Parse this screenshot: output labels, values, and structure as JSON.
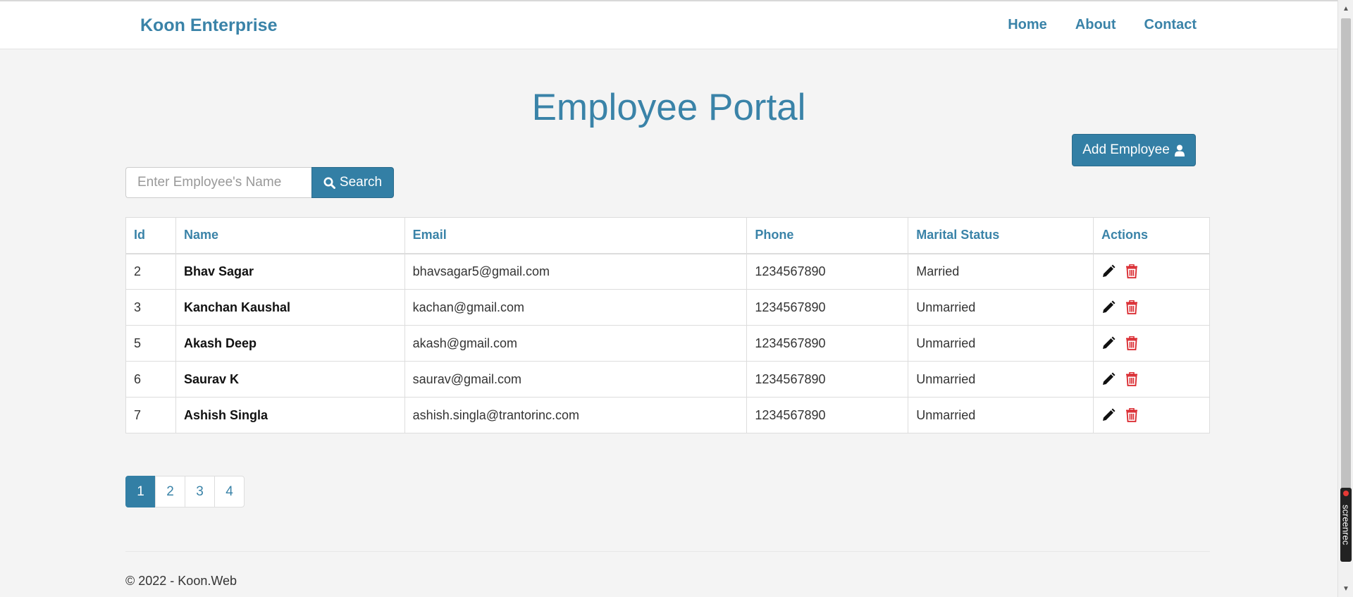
{
  "navbar": {
    "brand": "Koon Enterprise",
    "links": [
      "Home",
      "About",
      "Contact"
    ]
  },
  "main": {
    "title": "Employee Portal",
    "add_button_label": "Add Employee",
    "search": {
      "placeholder": "Enter Employee's Name",
      "value": "",
      "button_label": "Search"
    }
  },
  "table": {
    "columns": [
      "Id",
      "Name",
      "Email",
      "Phone",
      "Marital Status",
      "Actions"
    ],
    "rows": [
      {
        "id": "2",
        "name": "Bhav Sagar",
        "email": "bhavsagar5@gmail.com",
        "phone": "1234567890",
        "status": "Married"
      },
      {
        "id": "3",
        "name": "Kanchan Kaushal",
        "email": "kachan@gmail.com",
        "phone": "1234567890",
        "status": "Unmarried"
      },
      {
        "id": "5",
        "name": "Akash Deep",
        "email": "akash@gmail.com",
        "phone": "1234567890",
        "status": "Unmarried"
      },
      {
        "id": "6",
        "name": "Saurav K",
        "email": "saurav@gmail.com",
        "phone": "1234567890",
        "status": "Unmarried"
      },
      {
        "id": "7",
        "name": "Ashish Singla",
        "email": "ashish.singla@trantorinc.com",
        "phone": "1234567890",
        "status": "Unmarried"
      }
    ]
  },
  "pagination": {
    "pages": [
      "1",
      "2",
      "3",
      "4"
    ],
    "current": "1"
  },
  "footer": {
    "text": "© 2022 - Koon.Web"
  },
  "badge": {
    "text": "screenrec"
  },
  "icons": {
    "edit": "pencil-icon",
    "delete": "trash-icon",
    "search": "search-icon",
    "add": "user-icon"
  },
  "colors": {
    "accent": "#3a83a8",
    "button": "#337fa5",
    "delete": "#d9262c",
    "background": "#f4f4f4"
  }
}
